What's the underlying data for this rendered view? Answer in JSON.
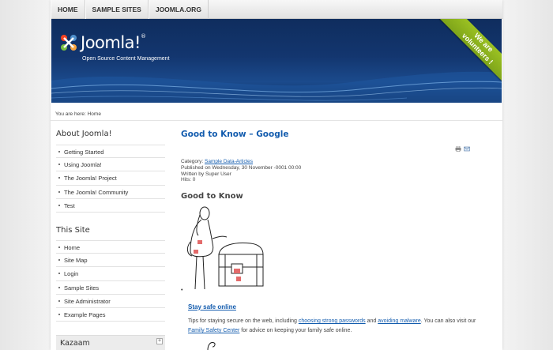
{
  "nav": {
    "items": [
      "HOME",
      "SAMPLE SITES",
      "JOOMLA.ORG"
    ]
  },
  "header": {
    "logo_text": "Joomla!",
    "tagline": "Open Source Content Management",
    "ribbon_line1": "We are",
    "ribbon_line2": "volunteers !",
    "ribbon_color": "#9bc122",
    "bg_color": "#13366f"
  },
  "breadcrumb": "You are here: Home",
  "about": {
    "title": "About Joomla!",
    "items": [
      "Getting Started",
      "Using Joomla!",
      "The Joomla! Project",
      "The Joomla! Community",
      "Test"
    ]
  },
  "this_site": {
    "title": "This Site",
    "items": [
      "Home",
      "Site Map",
      "Login",
      "Sample Sites",
      "Site Administrator",
      "Example Pages"
    ]
  },
  "kazaam": {
    "title": "Kazaam",
    "toggle": "+"
  },
  "article": {
    "title": "Good to Know – Google",
    "category_label": "Category: ",
    "category_link": "Sample Data-Articles",
    "published": "Published on Wednesday, 30 November -0001 00:00",
    "written_by": "Written by Super User",
    "hits": "Hits: 0",
    "subheading": "Good to Know",
    "bullet": "•",
    "stay_safe_link": "Stay safe online",
    "para_1": "Tips for staying secure on the web, including ",
    "link_passwords": "choosing strong passwords",
    "para_2": " and ",
    "link_malware": "avoiding malware",
    "para_3": ". You can also visit our ",
    "link_center": "Family Safety Center",
    "para_4": " for advice on keeping your family safe online.",
    "icons": [
      "print-icon",
      "email-icon"
    ]
  },
  "accent_color": "#135cae"
}
